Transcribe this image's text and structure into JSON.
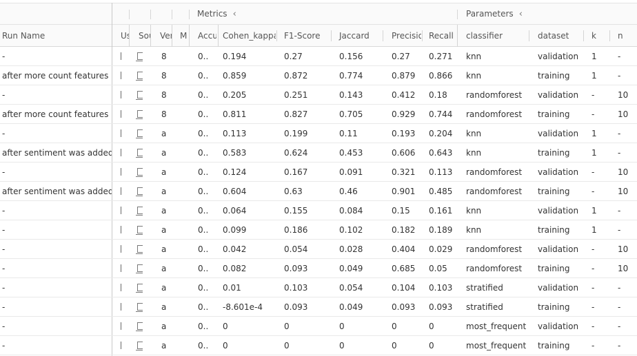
{
  "groups": {
    "metrics_label": "Metrics",
    "parameters_label": "Parameters"
  },
  "headers": {
    "run_name": "Run Name",
    "user": "Us",
    "source": "Sou",
    "version": "Ver",
    "models": "M",
    "accuracy": "Accu",
    "cohen_kappa": "Cohen_kappa",
    "f1": "F1-Score",
    "jaccard": "Jaccard",
    "precision": "Precisio",
    "recall": "Recall",
    "classifier": "classifier",
    "dataset": "dataset",
    "k": "k",
    "n": "n"
  },
  "icons": {
    "collapse_metrics": "chevron-left-icon",
    "collapse_parameters": "chevron-left-icon",
    "source": "source-code-icon",
    "user": "user-marker-icon"
  },
  "rows": [
    {
      "run_name": "-",
      "version": "8",
      "accuracy": "0..",
      "cohen_kappa": "0.194",
      "f1": "0.27",
      "jaccard": "0.156",
      "precision": "0.27",
      "recall": "0.271",
      "classifier": "knn",
      "dataset": "validation",
      "k": "1",
      "n": "-"
    },
    {
      "run_name": "after more count features",
      "version": "8",
      "accuracy": "0..",
      "cohen_kappa": "0.859",
      "f1": "0.872",
      "jaccard": "0.774",
      "precision": "0.879",
      "recall": "0.866",
      "classifier": "knn",
      "dataset": "training",
      "k": "1",
      "n": "-"
    },
    {
      "run_name": "-",
      "version": "8",
      "accuracy": "0..",
      "cohen_kappa": "0.205",
      "f1": "0.251",
      "jaccard": "0.143",
      "precision": "0.412",
      "recall": "0.18",
      "classifier": "randomforest",
      "dataset": "validation",
      "k": "-",
      "n": "10"
    },
    {
      "run_name": "after more count features",
      "version": "8",
      "accuracy": "0..",
      "cohen_kappa": "0.811",
      "f1": "0.827",
      "jaccard": "0.705",
      "precision": "0.929",
      "recall": "0.744",
      "classifier": "randomforest",
      "dataset": "training",
      "k": "-",
      "n": "10"
    },
    {
      "run_name": "-",
      "version": "a",
      "accuracy": "0..",
      "cohen_kappa": "0.113",
      "f1": "0.199",
      "jaccard": "0.11",
      "precision": "0.193",
      "recall": "0.204",
      "classifier": "knn",
      "dataset": "validation",
      "k": "1",
      "n": "-"
    },
    {
      "run_name": "after sentiment was added",
      "version": "a",
      "accuracy": "0..",
      "cohen_kappa": "0.583",
      "f1": "0.624",
      "jaccard": "0.453",
      "precision": "0.606",
      "recall": "0.643",
      "classifier": "knn",
      "dataset": "training",
      "k": "1",
      "n": "-"
    },
    {
      "run_name": "-",
      "version": "a",
      "accuracy": "0..",
      "cohen_kappa": "0.124",
      "f1": "0.167",
      "jaccard": "0.091",
      "precision": "0.321",
      "recall": "0.113",
      "classifier": "randomforest",
      "dataset": "validation",
      "k": "-",
      "n": "10"
    },
    {
      "run_name": "after sentiment was added",
      "version": "a",
      "accuracy": "0..",
      "cohen_kappa": "0.604",
      "f1": "0.63",
      "jaccard": "0.46",
      "precision": "0.901",
      "recall": "0.485",
      "classifier": "randomforest",
      "dataset": "training",
      "k": "-",
      "n": "10"
    },
    {
      "run_name": "-",
      "version": "a",
      "accuracy": "0..",
      "cohen_kappa": "0.064",
      "f1": "0.155",
      "jaccard": "0.084",
      "precision": "0.15",
      "recall": "0.161",
      "classifier": "knn",
      "dataset": "validation",
      "k": "1",
      "n": "-"
    },
    {
      "run_name": "-",
      "version": "a",
      "accuracy": "0..",
      "cohen_kappa": "0.099",
      "f1": "0.186",
      "jaccard": "0.102",
      "precision": "0.182",
      "recall": "0.189",
      "classifier": "knn",
      "dataset": "training",
      "k": "1",
      "n": "-"
    },
    {
      "run_name": "-",
      "version": "a",
      "accuracy": "0..",
      "cohen_kappa": "0.042",
      "f1": "0.054",
      "jaccard": "0.028",
      "precision": "0.404",
      "recall": "0.029",
      "classifier": "randomforest",
      "dataset": "validation",
      "k": "-",
      "n": "10"
    },
    {
      "run_name": "-",
      "version": "a",
      "accuracy": "0..",
      "cohen_kappa": "0.082",
      "f1": "0.093",
      "jaccard": "0.049",
      "precision": "0.685",
      "recall": "0.05",
      "classifier": "randomforest",
      "dataset": "training",
      "k": "-",
      "n": "10"
    },
    {
      "run_name": "-",
      "version": "a",
      "accuracy": "0..",
      "cohen_kappa": "0.01",
      "f1": "0.103",
      "jaccard": "0.054",
      "precision": "0.104",
      "recall": "0.103",
      "classifier": "stratified",
      "dataset": "validation",
      "k": "-",
      "n": "-"
    },
    {
      "run_name": "-",
      "version": "a",
      "accuracy": "0..",
      "cohen_kappa": "-8.601e-4",
      "f1": "0.093",
      "jaccard": "0.049",
      "precision": "0.093",
      "recall": "0.093",
      "classifier": "stratified",
      "dataset": "training",
      "k": "-",
      "n": "-"
    },
    {
      "run_name": "-",
      "version": "a",
      "accuracy": "0..",
      "cohen_kappa": "0",
      "f1": "0",
      "jaccard": "0",
      "precision": "0",
      "recall": "0",
      "classifier": "most_frequent",
      "dataset": "validation",
      "k": "-",
      "n": "-"
    },
    {
      "run_name": "-",
      "version": "a",
      "accuracy": "0..",
      "cohen_kappa": "0",
      "f1": "0",
      "jaccard": "0",
      "precision": "0",
      "recall": "0",
      "classifier": "most_frequent",
      "dataset": "training",
      "k": "-",
      "n": "-"
    }
  ]
}
